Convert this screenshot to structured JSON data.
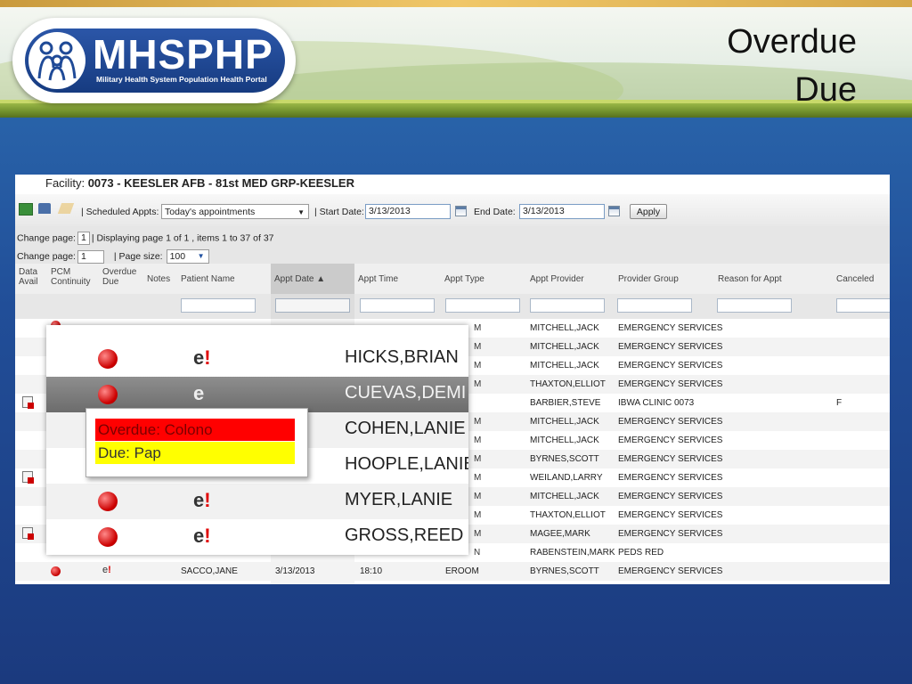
{
  "slide": {
    "title_line1": "Overdue",
    "title_line2": "Due"
  },
  "logo": {
    "brand": "MHSPHP",
    "tagline": "Military Health System Population Health Portal"
  },
  "facility": {
    "label": "Facility:",
    "value": "0073 - KEESLER AFB - 81st MED GRP-KEESLER"
  },
  "toolbar": {
    "scheduled_label": "| Scheduled Appts:",
    "scheduled_value": "Today's appointments",
    "start_label": "| Start Date:",
    "start_value": "3/13/2013",
    "end_label": "End Date:",
    "end_value": "3/13/2013",
    "apply_label": "Apply"
  },
  "pager": {
    "change_page_label": "Change page:",
    "page_value": "1",
    "displaying": "| Displaying page 1 of 1 , items 1 to 37 of 37",
    "page_size_label": "| Page size:",
    "page_size_value": "100"
  },
  "columns": {
    "data_avail_1": "Data",
    "data_avail_2": "Avail",
    "pcm_1": "PCM",
    "pcm_2": "Continuity",
    "overdue_1": "Overdue",
    "overdue_2": "Due",
    "notes": "Notes",
    "patient": "Patient Name",
    "date": "Appt Date ▲",
    "time": "Appt Time",
    "type": "Appt Type",
    "provider": "Appt Provider",
    "group": "Provider Group",
    "reason": "Reason for Appt",
    "canceled": "Canceled"
  },
  "rows": [
    {
      "clip": "M",
      "provider": "MITCHELL,JACK",
      "group": "EMERGENCY SERVICES",
      "canceled": ""
    },
    {
      "clip": "M",
      "provider": "MITCHELL,JACK",
      "group": "EMERGENCY SERVICES",
      "canceled": ""
    },
    {
      "clip": "M",
      "provider": "MITCHELL,JACK",
      "group": "EMERGENCY SERVICES",
      "canceled": ""
    },
    {
      "clip": "M",
      "provider": "THAXTON,ELLIOT",
      "group": "EMERGENCY SERVICES",
      "canceled": ""
    },
    {
      "clip": "",
      "provider": "BARBIER,STEVE",
      "group": "IBWA CLINIC 0073",
      "canceled": "F"
    },
    {
      "clip": "M",
      "provider": "MITCHELL,JACK",
      "group": "EMERGENCY SERVICES",
      "canceled": ""
    },
    {
      "clip": "M",
      "provider": "MITCHELL,JACK",
      "group": "EMERGENCY SERVICES",
      "canceled": ""
    },
    {
      "clip": "M",
      "provider": "BYRNES,SCOTT",
      "group": "EMERGENCY SERVICES",
      "canceled": ""
    },
    {
      "clip": "M",
      "provider": "WEILAND,LARRY",
      "group": "EMERGENCY SERVICES",
      "canceled": ""
    },
    {
      "clip": "M",
      "provider": "MITCHELL,JACK",
      "group": "EMERGENCY SERVICES",
      "canceled": ""
    },
    {
      "clip": "M",
      "provider": "THAXTON,ELLIOT",
      "group": "EMERGENCY SERVICES",
      "canceled": ""
    },
    {
      "clip": "M",
      "provider": "MAGEE,MARK",
      "group": "EMERGENCY SERVICES",
      "canceled": ""
    },
    {
      "clip": "N",
      "provider": "RABENSTEIN,MARK",
      "group": "PEDS RED",
      "canceled": ""
    },
    {
      "clip": "",
      "patient": "SACCO,JANE",
      "date": "3/13/2013",
      "time": "18:10",
      "type": "EROOM",
      "provider": "BYRNES,SCOTT",
      "group": "EMERGENCY SERVICES",
      "canceled": ""
    }
  ],
  "zoom_rows": [
    {
      "name": "HICKS,BRIAN"
    },
    {
      "name": "CUEVAS,DEMI"
    },
    {
      "name": "COHEN,LANIE"
    },
    {
      "name": "HOOPLE,LANIE"
    },
    {
      "name": "MYER,LANIE"
    },
    {
      "name": "GROSS,REED"
    }
  ],
  "tooltip": {
    "overdue": "Overdue: Colono",
    "due": "Due: Pap"
  },
  "icon_glyph": {
    "e": "e",
    "bang": "!"
  },
  "colors": {
    "overdue": "#ff0000",
    "due": "#ffff00",
    "brand": "#1f4a97"
  }
}
